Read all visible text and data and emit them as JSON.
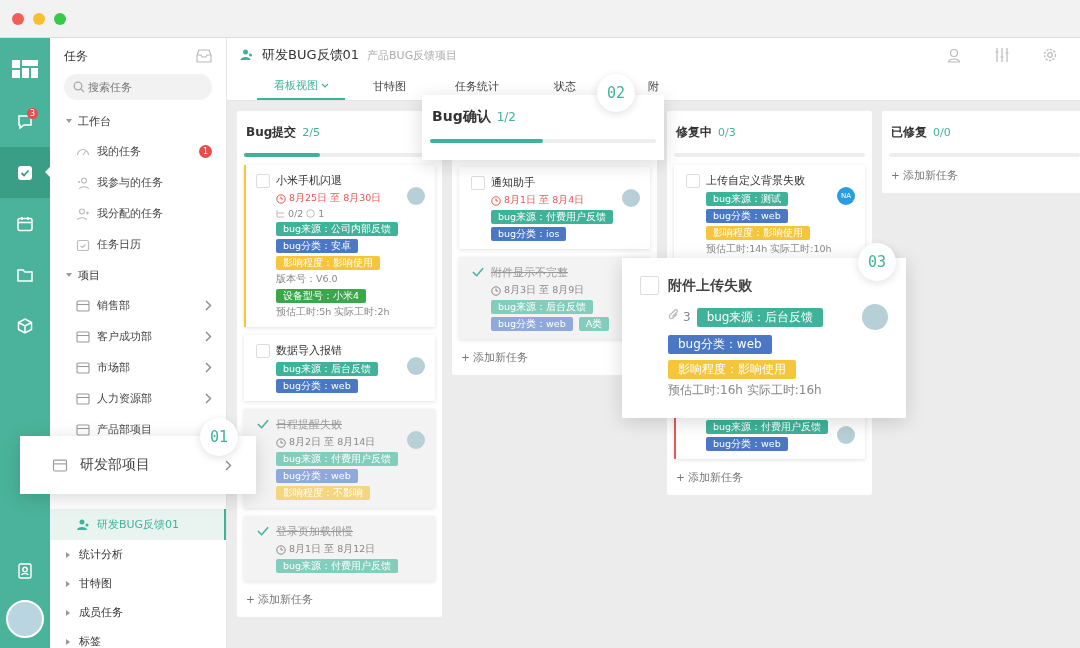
{
  "rail": {
    "items": [
      {
        "kind": "chat",
        "badge": "3",
        "selected": false
      },
      {
        "kind": "task",
        "selected": true
      },
      {
        "kind": "calendar",
        "selected": false
      },
      {
        "kind": "folder",
        "selected": false
      },
      {
        "kind": "cube",
        "selected": false
      }
    ]
  },
  "sidebar": {
    "title": "任务",
    "search": {
      "placeholder": "搜索任务"
    },
    "sections": [
      {
        "label": "工作台",
        "expanded": true,
        "children": [
          {
            "label": "我的任务",
            "kind": "gauge",
            "badge": "1",
            "arrow": false,
            "selected": false
          },
          {
            "label": "我参与的任务",
            "kind": "person",
            "arrow": false,
            "selected": false
          },
          {
            "label": "我分配的任务",
            "kind": "person-plus",
            "arrow": false,
            "selected": false
          },
          {
            "label": "任务日历",
            "kind": "calendar",
            "arrow": false,
            "selected": false
          }
        ]
      },
      {
        "label": "项目",
        "expanded": true,
        "children": [
          {
            "label": "销售部",
            "kind": "folder",
            "arrow": true,
            "selected": false
          },
          {
            "label": "客户成功部",
            "kind": "folder",
            "arrow": true,
            "selected": false
          },
          {
            "label": "市场部",
            "kind": "folder",
            "arrow": true,
            "selected": false
          },
          {
            "label": "人力资源部",
            "kind": "folder",
            "arrow": true,
            "selected": false
          },
          {
            "label": "产品部项目",
            "kind": "folder",
            "arrow": false,
            "selected": false
          },
          {
            "label": "研发BUG反馈01",
            "kind": "project",
            "arrow": false,
            "selected": true
          }
        ]
      },
      {
        "label": "统计分析",
        "expanded": false
      },
      {
        "label": "甘特图",
        "expanded": false
      },
      {
        "label": "成员任务",
        "expanded": false
      },
      {
        "label": "标签",
        "expanded": false
      }
    ]
  },
  "header": {
    "title": "研发BUG反馈01",
    "subtitle": "产品BUG反馈项目",
    "tabs": [
      {
        "label": "看板视图",
        "dropdown": true,
        "selected": true
      },
      {
        "label": "甘特图",
        "dropdown": false,
        "selected": false
      },
      {
        "label": "任务统计",
        "dropdown": false,
        "selected": false
      },
      {
        "label": "状态",
        "dropdown": false,
        "selected": false
      },
      {
        "label": "附",
        "dropdown": false,
        "selected": false
      }
    ]
  },
  "board": {
    "columns": [
      {
        "title": "Bug提交",
        "count": "2/5",
        "level": 0.4,
        "add_label": "+ 添加新任务",
        "cards": [
          {
            "title": "小米手机闪退",
            "done": false,
            "date": "8月25日 至 8月30日",
            "overdue": true,
            "subtasks": "0/2",
            "comments": "1",
            "color": "#f5c63b",
            "avatar": {
              "kind": "photo"
            },
            "lines": [
              {
                "kind": "tag",
                "text": "bug来源：公司内部反馈",
                "color": "#3fb39a"
              },
              {
                "kind": "tag",
                "text": "bug分类：安卓",
                "color": "#4a78c4"
              },
              {
                "kind": "tag",
                "text": "影响程度：影响使用",
                "color": "#f5c63b"
              },
              {
                "kind": "text",
                "text": "版本号：V6.0"
              },
              {
                "kind": "tag",
                "text": "设备型号：小米4",
                "color": "#3aa84a"
              }
            ],
            "hours": "预估工时:5h  实际工时:2h"
          },
          {
            "title": "数据导入报错",
            "done": false,
            "avatar": {
              "kind": "photo"
            },
            "lines": [
              {
                "kind": "tag",
                "text": "bug来源：后台反馈",
                "color": "#3fb39a"
              },
              {
                "kind": "tag",
                "text": "bug分类：web",
                "color": "#4a78c4"
              }
            ]
          },
          {
            "title": "日程提醒失败",
            "done": true,
            "date": "8月2日 至 8月14日",
            "overdue": false,
            "avatar": {
              "kind": "photo"
            },
            "lines": [
              {
                "kind": "tag",
                "text": "bug来源：付费用户反馈",
                "color": "#82cdbb"
              },
              {
                "kind": "tag",
                "text": "bug分类：web",
                "color": "#8fa9dc"
              },
              {
                "kind": "tag",
                "text": "影响程度：不影响",
                "color": "#f3d67e"
              }
            ]
          },
          {
            "title": "登录页加载很慢",
            "done": true,
            "date": "8月1日 至 8月12日",
            "overdue": false,
            "lines": [
              {
                "kind": "tag",
                "text": "bug来源：付费用户反馈",
                "color": "#82cdbb"
              }
            ]
          }
        ]
      },
      {
        "add_label": "+ 添加新任务",
        "cards": [
          {
            "title": "通知助手",
            "done": false,
            "date": "8月1日 至 8月4日",
            "overdue": true,
            "avatar": {
              "kind": "photo"
            },
            "lines": [
              {
                "kind": "tag",
                "text": "bug来源：付费用户反馈",
                "color": "#3fb39a"
              },
              {
                "kind": "tag",
                "text": "bug分类：ios",
                "color": "#4a78c4"
              }
            ]
          },
          {
            "title": "附件显示不完整",
            "done": true,
            "date": "8月3日 至 8月9日",
            "overdue": false,
            "lines": [
              {
                "kind": "tag",
                "text": "bug来源：后台反馈",
                "color": "#82cdbb"
              },
              {
                "kind": "tags",
                "items": [
                  {
                    "text": "bug分类：web",
                    "color": "#8fa9dc"
                  },
                  {
                    "text": "A类",
                    "color": "#82cdbb"
                  }
                ]
              }
            ]
          }
        ]
      },
      {
        "title": "修复中",
        "count": "0/3",
        "level": 0,
        "add_label": "+ 添加新任务",
        "cards": [
          {
            "title": "上传自定义背景失败",
            "done": false,
            "avatar": {
              "kind": "initials",
              "text": "NA"
            },
            "lines": [
              {
                "kind": "tag",
                "text": "bug来源：测试",
                "color": "#3fb39a"
              },
              {
                "kind": "tag",
                "text": "bug分类：web",
                "color": "#4a78c4"
              },
              {
                "kind": "tag",
                "text": "影响程度：影响使用",
                "color": "#f5c63b"
              }
            ],
            "hours": "预估工时:14h  实际工时:10h"
          },
          {
            "done": false,
            "color": "#e05a5a",
            "avatar": {
              "kind": "photo"
            },
            "lines": [
              {
                "kind": "tag",
                "text": "bug来源：付费用户反馈",
                "color": "#3fb39a"
              },
              {
                "kind": "tag",
                "text": "bug分类：web",
                "color": "#4a78c4"
              }
            ]
          }
        ]
      },
      {
        "title": "已修复",
        "count": "0/0",
        "level": 0,
        "add_label": "+ 添加新任务"
      }
    ]
  },
  "callouts": {
    "sidebar_item": {
      "number": "01",
      "label": "研发部项目"
    },
    "column_header": {
      "number": "02",
      "title": "Bug确认",
      "count": "1/2",
      "level": 0.5
    },
    "task_card": {
      "number": "03",
      "title": "附件上传失败",
      "done": false,
      "attachments": "3",
      "tags": [
        {
          "text": "bug来源：后台反馈",
          "color": "#3fb39a"
        },
        {
          "text": "bug分类：web",
          "color": "#4a78c4"
        },
        {
          "text": "影响程度：影响使用",
          "color": "#f5c63b"
        }
      ],
      "hours": "预估工时:16h  实际工时:16h"
    }
  }
}
